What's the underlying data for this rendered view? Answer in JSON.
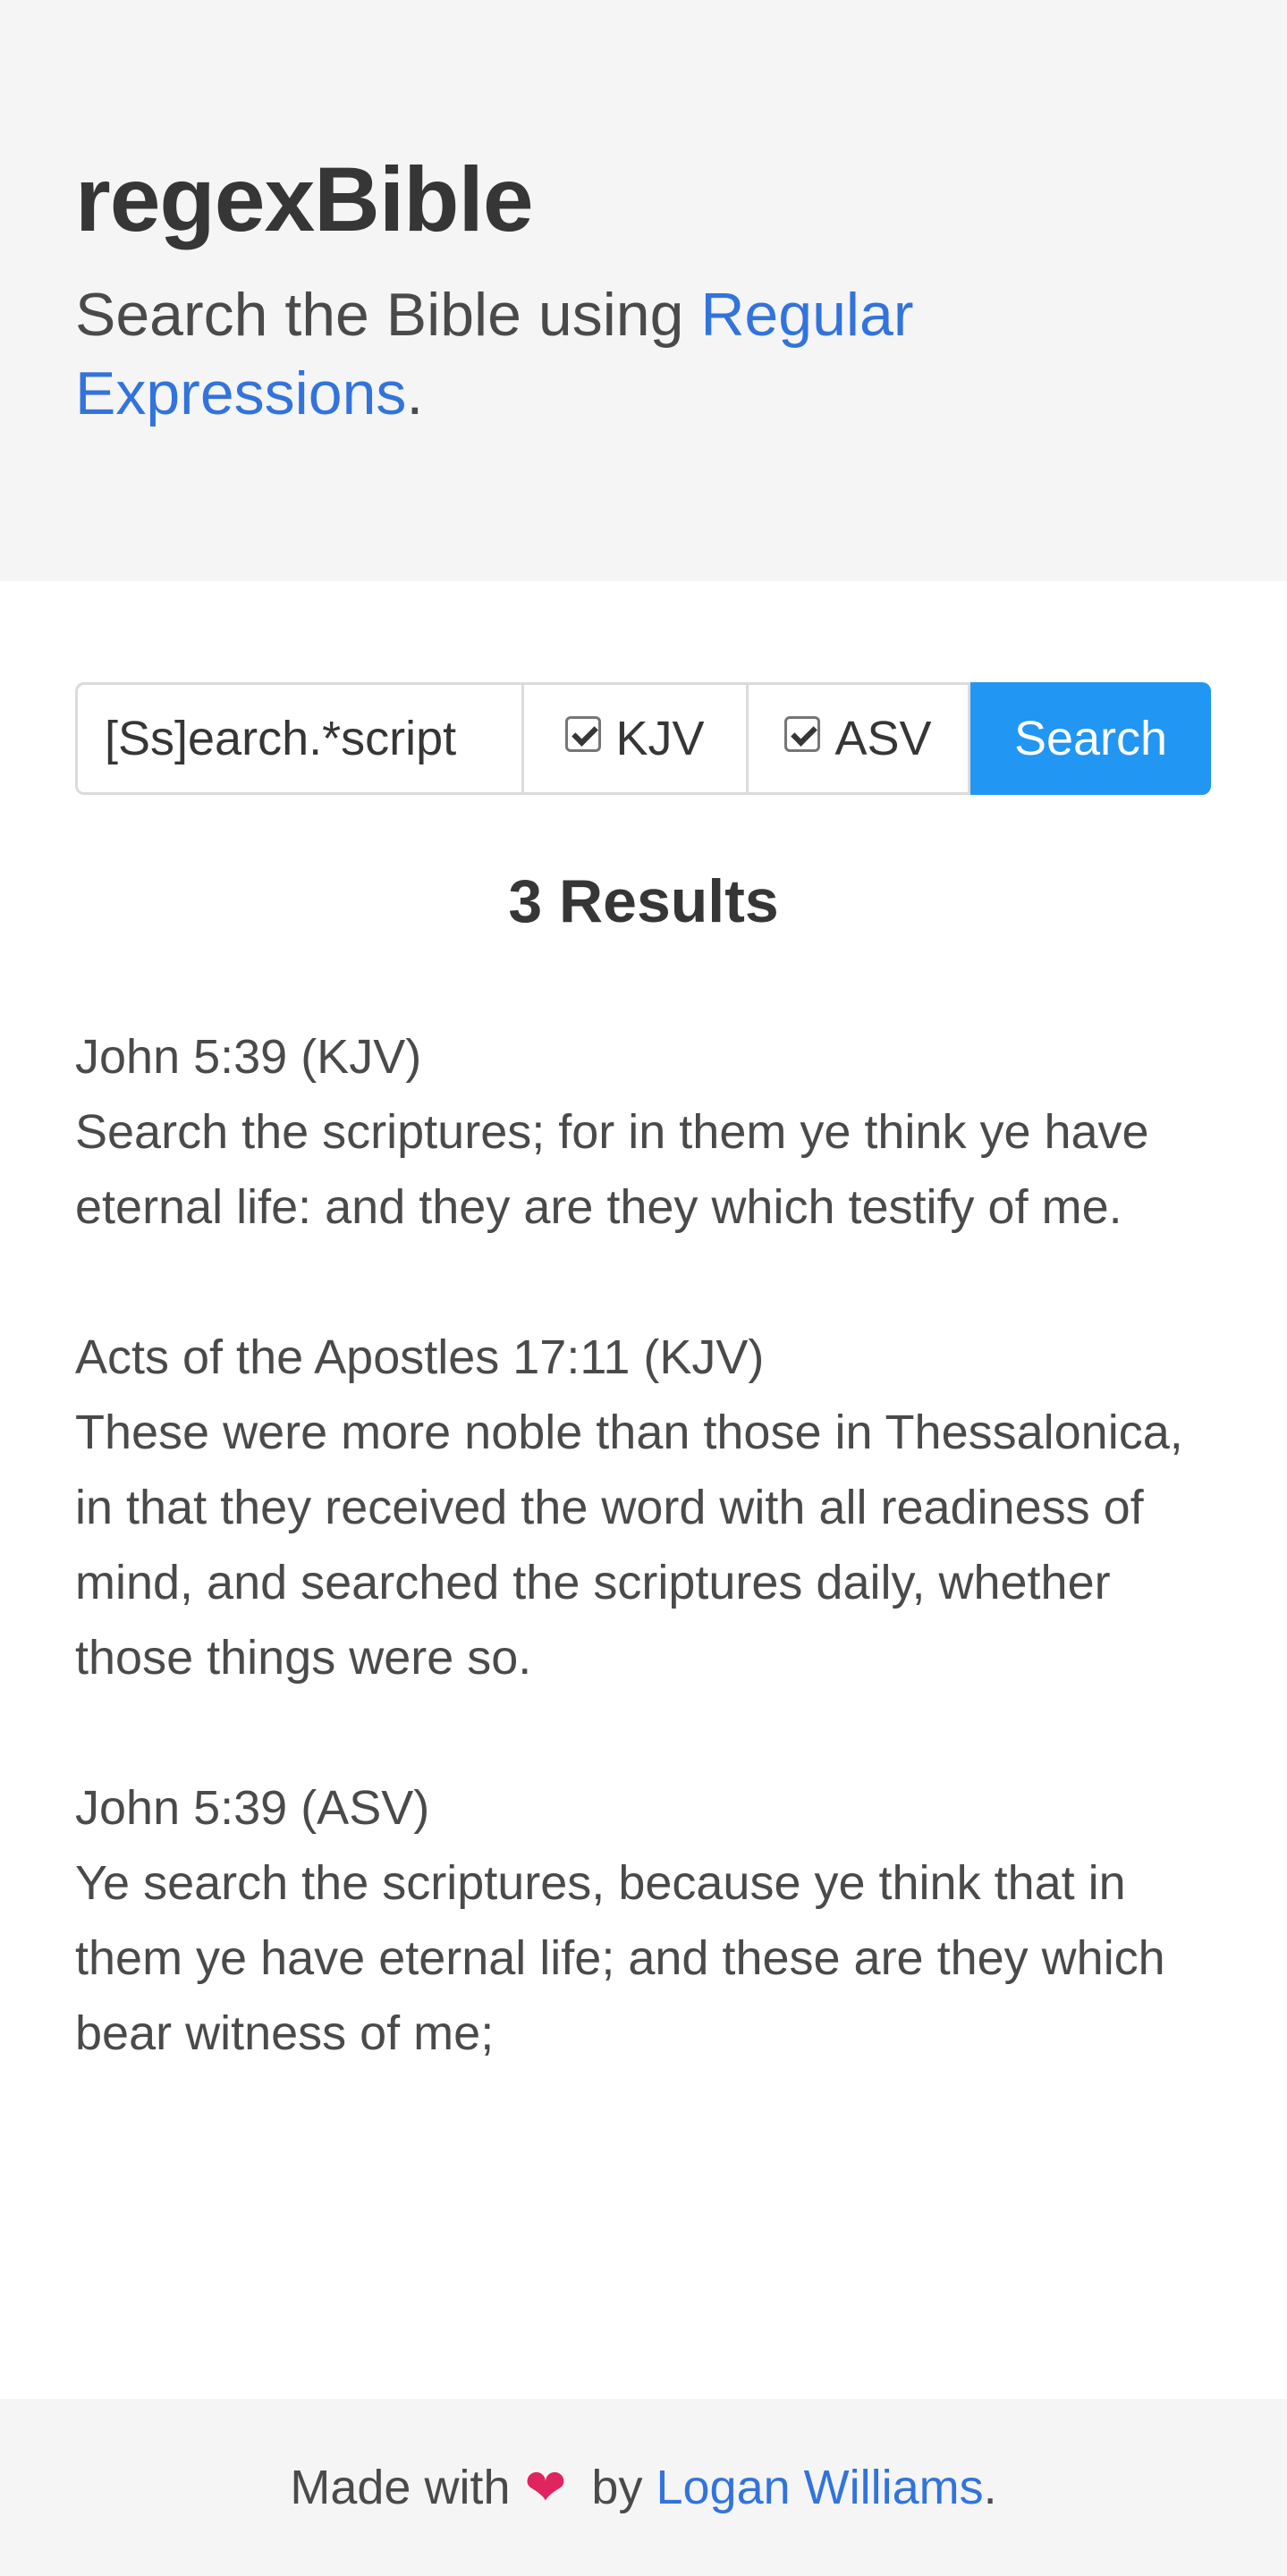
{
  "hero": {
    "title": "regexBible",
    "subtitle_prefix": "Search the Bible using ",
    "subtitle_link": "Regular Expressions",
    "subtitle_suffix": "."
  },
  "search": {
    "query": "[Ss]earch.*script",
    "versions": [
      {
        "label": "KJV",
        "checked": true
      },
      {
        "label": "ASV",
        "checked": true
      }
    ],
    "button_label": "Search"
  },
  "results": {
    "heading": "3 Results",
    "items": [
      {
        "reference": "John 5:39 (KJV)",
        "text": "Search the scriptures; for in them ye think ye have eternal life: and they are they which testify of me."
      },
      {
        "reference": "Acts of the Apostles 17:11 (KJV)",
        "text": "These were more noble than those in Thessalonica, in that they received the word with all readiness of mind, and searched the scriptures daily, whether those things were so."
      },
      {
        "reference": "John 5:39 (ASV)",
        "text": "Ye search the scriptures, because ye think that in them ye have eternal life; and these are they which bear witness of me;"
      }
    ]
  },
  "footer": {
    "prefix": "Made with",
    "heart": "❤",
    "by": "by",
    "author": "Logan Williams",
    "suffix": "."
  },
  "colors": {
    "link": "#3273dc",
    "button": "#2196f3",
    "heart": "#e0245e",
    "hero_bg": "#f5f5f5"
  }
}
